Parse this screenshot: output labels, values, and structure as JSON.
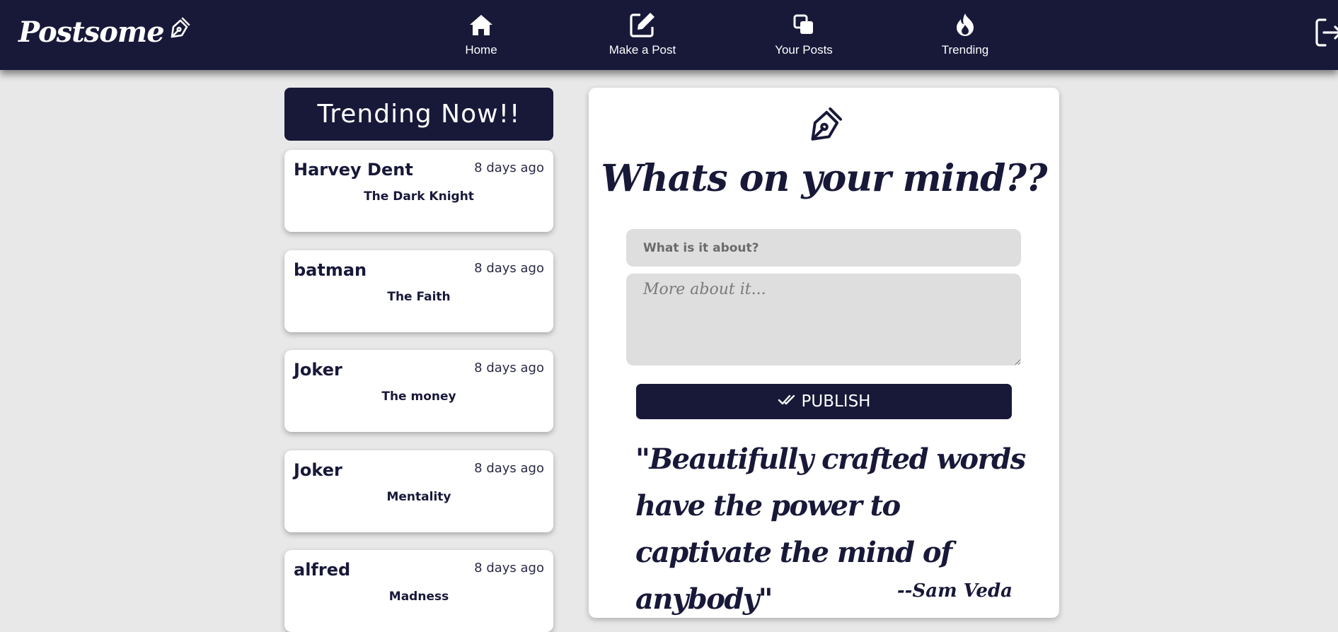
{
  "brand": {
    "name": "Postsome",
    "icon": "fountain-pen-icon"
  },
  "nav": {
    "items": [
      {
        "label": "Home",
        "icon": "home-icon"
      },
      {
        "label": "Make a Post",
        "icon": "edit-icon"
      },
      {
        "label": "Your Posts",
        "icon": "copy-icon"
      },
      {
        "label": "Trending",
        "icon": "fire-icon"
      }
    ],
    "logout_icon": "logout-icon"
  },
  "trending": {
    "heading": "Trending Now!!",
    "posts": [
      {
        "author": "Harvey Dent",
        "time": "8 days ago",
        "title": "The Dark Knight"
      },
      {
        "author": "batman",
        "time": "8 days ago",
        "title": "The Faith"
      },
      {
        "author": "Joker",
        "time": "8 days ago",
        "title": "The money"
      },
      {
        "author": "Joker",
        "time": "8 days ago",
        "title": "Mentality"
      },
      {
        "author": "alfred",
        "time": "8 days ago",
        "title": "Madness"
      }
    ]
  },
  "composer": {
    "icon": "fountain-pen-icon",
    "heading": "Whats on your mind??",
    "title_placeholder": "What is it about?",
    "title_value": "",
    "body_placeholder": "More about it...",
    "body_value": "",
    "publish_label": "PUBLISH",
    "publish_icon": "double-check-icon"
  },
  "quote": {
    "text": "\"Beautifully crafted words have the power to captivate the mind of anybody\"",
    "author": "--Sam Veda"
  },
  "colors": {
    "primary": "#181839",
    "background": "#e8e8e8",
    "card": "#ffffff",
    "input": "#dedede"
  }
}
